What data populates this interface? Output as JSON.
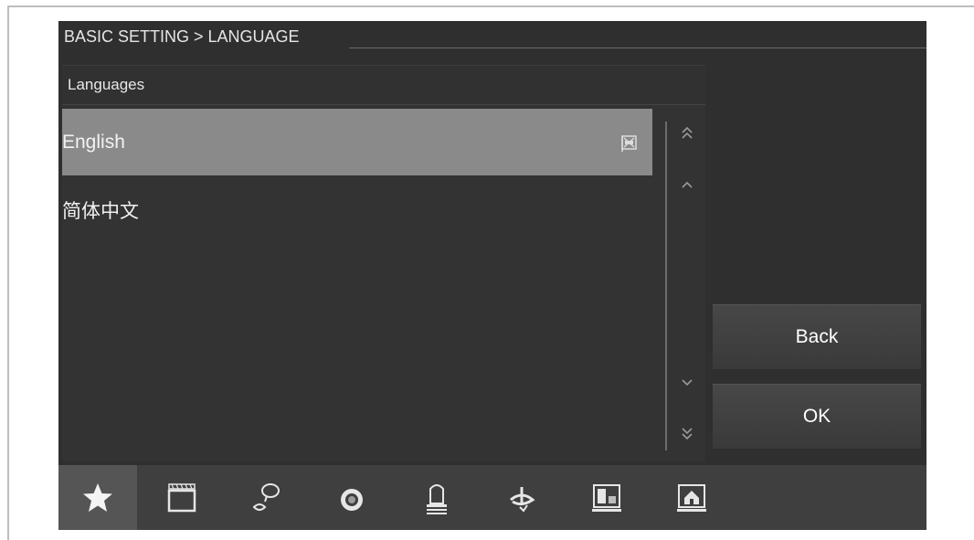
{
  "title": "BASIC SETTING > LANGUAGE",
  "list": {
    "header": "Languages",
    "items": [
      {
        "label": "English",
        "selected": true
      },
      {
        "label": "简体中文",
        "selected": false
      }
    ]
  },
  "buttons": {
    "back": "Back",
    "ok": "OK"
  },
  "scroll": {
    "double_up": "scroll-top-icon",
    "up": "scroll-up-icon",
    "down": "scroll-down-icon",
    "double_down": "scroll-bottom-icon"
  },
  "toolbar": {
    "items": [
      {
        "icon": "star-icon",
        "active": true
      },
      {
        "icon": "clapperboard-icon",
        "active": false
      },
      {
        "icon": "speech-bubble-icon",
        "active": false
      },
      {
        "icon": "camera-lens-icon",
        "active": false
      },
      {
        "icon": "alarm-light-icon",
        "active": false
      },
      {
        "icon": "rotate-arrow-icon",
        "active": false
      },
      {
        "icon": "building-icon",
        "active": false
      },
      {
        "icon": "home-icon",
        "active": false
      }
    ]
  },
  "colors": {
    "screen_bg": "#2f2f2f",
    "selected_row": "#8a8a8a",
    "toolbar_bg": "#3f3f3f",
    "text": "#ffffff"
  }
}
